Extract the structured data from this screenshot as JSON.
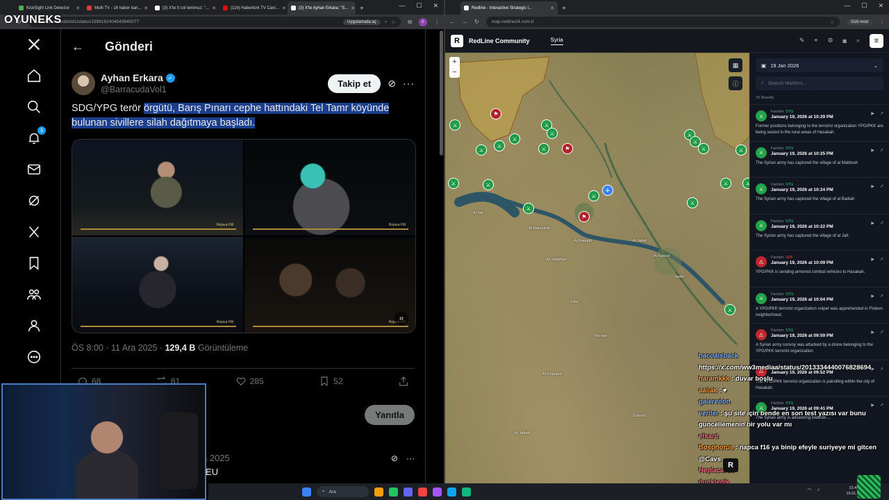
{
  "stream_logo": "OYUNEKS",
  "left_browser": {
    "tabs": [
      {
        "label": "KickSight Link Detector",
        "color": "#4caf50"
      },
      {
        "label": "Multi TV - 16 haber kan...",
        "color": "#e53935"
      },
      {
        "label": "(3) X'te It col temmuz: \"...",
        "color": "#ffffff"
      },
      {
        "label": "(116) Habertürk TV Canl...",
        "color": "#ff0000"
      },
      {
        "label": "(3) X'te Ayhan Erkara: \"S...",
        "color": "#ffffff",
        "active": true
      }
    ],
    "url": "x.com/BarracudaVol1/status/1999162404043940077",
    "open_in_app": "Uygulamada aç",
    "profile_initial": "c"
  },
  "x": {
    "notification_count": "3",
    "header_title": "Gönderi",
    "author_name": "Ayhan Erkara",
    "author_handle": "@BarracudaVol1",
    "follow_label": "Takip et",
    "tweet_text_plain": "SDG/YPG terör ",
    "tweet_text_highlight": "örgütü, Barış Pınarı cephe hattındaki Tel Tamr köyünde bulunan sivillere silah dağıtmaya başladı.",
    "watermark": "Rojava FM",
    "timestamp": "ÖS 8:00 · 11 Ara 2025 · ",
    "views_count": "129,4 B",
    "views_label": "Görüntüleme",
    "replies": "68",
    "reposts": "81",
    "likes": "285",
    "bookmarks": "52",
    "reply_button": "Yanıtla",
    "next_post_date": "Ara 2025",
    "next_post_text": "EHEU"
  },
  "right_browser": {
    "tab_label": "Redline - Interactive Strategic I...",
    "url": "map.redline24.com.tr",
    "incognito": "Gizli mod"
  },
  "redline": {
    "logo": "R",
    "title": "RedLine Community",
    "region_tab": "Syria",
    "date": "19 Jan 2026",
    "search_placeholder": "Search Markers...",
    "results": "75 Results",
    "faction_label": "Faction:",
    "items": [
      {
        "faction": "STG",
        "date": "January 19, 2026 at 10:29 PM",
        "text": "Former positions belonging to the terrorist organization YPG/PKK are being seized in the rural areas of Hasakah.",
        "hostile": false
      },
      {
        "faction": "STG",
        "date": "January 19, 2026 at 10:25 PM",
        "text": "The Syrian army has captured the village of al Mabtouh",
        "hostile": false
      },
      {
        "faction": "STG",
        "date": "January 19, 2026 at 10:24 PM",
        "text": "The Syrian army has captured the village of al Badiah",
        "hostile": false
      },
      {
        "faction": "STG",
        "date": "January 19, 2026 at 10:22 PM",
        "text": "The Syrian army has captured the village of al Jafr.",
        "hostile": false
      },
      {
        "faction": "SDF",
        "date": "January 19, 2026 at 10:09 PM",
        "text": "YPG/PKK is sending armored combat vehicles to Hasakah.",
        "hostile": true
      },
      {
        "faction": "STG",
        "date": "January 19, 2026 at 10:04 PM",
        "text": "A YPG/PKK terrorist organization sniper was apprehended in Firdevs neighborhood.",
        "hostile": false
      },
      {
        "faction": "STG",
        "date": "January 19, 2026 at 09:59 PM",
        "text": "A Syrian army convoy was attacked by a drone belonging to the YPG/PKK terrorist organization",
        "hostile": true
      },
      {
        "faction": "STG",
        "date": "January 19, 2026 at 09:52 PM",
        "text": "The YPG/PKK terrorist organization is patrolling within the city of Hasakah.",
        "hostile": true
      },
      {
        "faction": "STG",
        "date": "January 19, 2026 at 09:41 PM",
        "text": "The Syrian army is advancing towards ...",
        "hostile": false
      }
    ],
    "places": [
      {
        "name": "Al Tall",
        "cls": "p1"
      },
      {
        "name": "Al Mansurah",
        "cls": "p2"
      },
      {
        "name": "Ar Raqqah",
        "cls": "p3"
      },
      {
        "name": "Al Jabal",
        "cls": "p4"
      },
      {
        "name": "As Sabkhah",
        "cls": "p5"
      },
      {
        "name": "Al Kasrah",
        "cls": "p6"
      },
      {
        "name": "Jadid",
        "cls": "p7"
      },
      {
        "name": "Tulul",
        "cls": "p8"
      },
      {
        "name": "Ma'dan",
        "cls": "p9"
      },
      {
        "name": "Al Ghanem",
        "cls": "p10"
      },
      {
        "name": "Suknah",
        "cls": "p11"
      },
      {
        "name": "Al Jafrah",
        "cls": "p12"
      }
    ]
  },
  "chat": [
    {
      "user": "bacoaisback",
      "msg": "",
      "color": "#7fb2ff"
    },
    {
      "user": "",
      "msg": "https://x.com/ww3mediaa/status/2013334440076828694",
      "color": "#ffffff"
    },
    {
      "user": "haramkkk",
      "msg": "duvar boşlu",
      "color": "#ff9f43"
    },
    {
      "user": "aallak",
      "msg": "♥",
      "color": "#ff9f43"
    },
    {
      "user": "galeredon",
      "msg": "",
      "color": "#7fb2ff"
    },
    {
      "user": "veriler",
      "msg": "şu site için bende en son test yazısı var bunu guncellemenin bir yolu var mı",
      "color": "#7fb2ff"
    },
    {
      "user": "efkard",
      "msg": "",
      "color": "#ff6b81"
    },
    {
      "user": "Bosphorus",
      "msg": "napca f16 ya binip efeyle suriyeye mi gitcen",
      "color": "#ff9f43"
    },
    {
      "user": "",
      "msg": "@Cavs",
      "color": "#ffffff"
    },
    {
      "user": "Heplacarus",
      "msg": "",
      "color": "#ff6b81"
    },
    {
      "user": "dunklenik",
      "msg": "",
      "color": "#ff6b81"
    }
  ],
  "taskbar": {
    "search": "Ara",
    "time": "21:48 ÖS",
    "date": "19.01.2026"
  }
}
